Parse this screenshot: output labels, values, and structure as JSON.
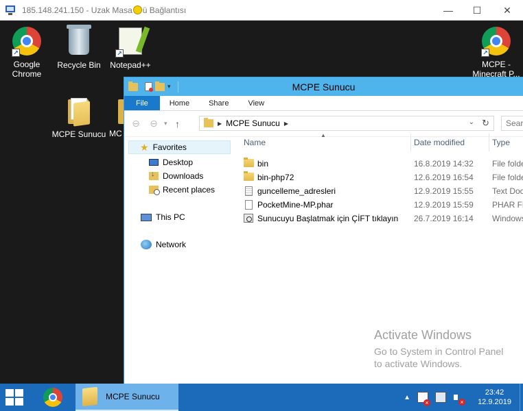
{
  "rdp": {
    "title_part1": "185.148.241.150 - Uzak Masa",
    "title_part2": "ü Bağlantısı",
    "minimize": "—",
    "maximize": "☐",
    "close": "✕"
  },
  "desktop": {
    "icons": [
      {
        "label": "Google\nChrome"
      },
      {
        "label": "Recycle Bin"
      },
      {
        "label": "Notepad++"
      },
      {
        "label": "MCPE Sunucu"
      },
      {
        "label": "MC"
      },
      {
        "label": "MCPE -\nMinecraft P..."
      }
    ]
  },
  "explorer": {
    "title": "MCPE Sunucu",
    "tabs": [
      "File",
      "Home",
      "Share",
      "View"
    ],
    "address": {
      "crumb": "MCPE Sunucu"
    },
    "search_placeholder": "Searc",
    "nav": {
      "favorites": "Favorites",
      "desktop": "Desktop",
      "downloads": "Downloads",
      "recent": "Recent places",
      "this_pc": "This PC",
      "network": "Network"
    },
    "columns": {
      "name": "Name",
      "date": "Date modified",
      "type": "Type"
    },
    "files": [
      {
        "name": "bin",
        "date": "16.8.2019 14:32",
        "type": "File folde",
        "icon": "folder-icon"
      },
      {
        "name": "bin-php72",
        "date": "12.6.2019 16:54",
        "type": "File folde",
        "icon": "folder-icon"
      },
      {
        "name": "guncelleme_adresleri",
        "date": "12.9.2019 15:55",
        "type": "Text Doc",
        "icon": "text-file-icon"
      },
      {
        "name": "PocketMine-MP.phar",
        "date": "12.9.2019 15:59",
        "type": "PHAR Fil",
        "icon": "file-icon"
      },
      {
        "name": "Sunucuyu Başlatmak için ÇİFT tıklayın",
        "date": "26.7.2019 16:14",
        "type": "Windows",
        "icon": "batch-file-icon"
      }
    ],
    "watermark": {
      "line1": "Activate Windows",
      "line2": "Go to System in Control Panel",
      "line3": "to activate Windows."
    }
  },
  "taskbar": {
    "active_window": "MCPE Sunucu",
    "time": "23:42",
    "date": "12.9.2019"
  },
  "colors": {
    "taskbar": "#1c6bba",
    "explorer_titlebar": "#4fb3ec",
    "file_tab": "#1979ca",
    "desktop": "#1a1a1a"
  }
}
